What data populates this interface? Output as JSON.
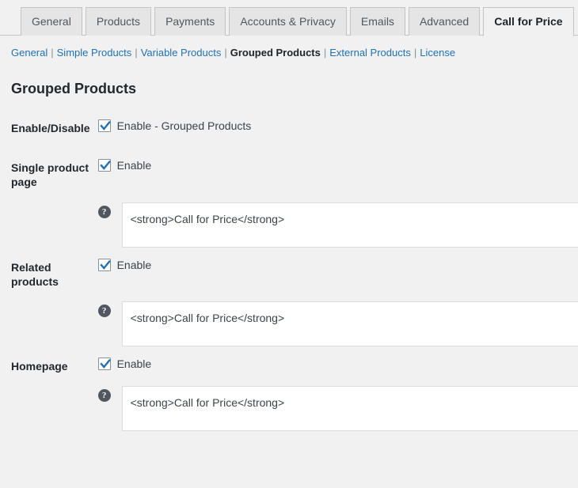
{
  "tabs": [
    {
      "label": "General",
      "active": false
    },
    {
      "label": "Products",
      "active": false
    },
    {
      "label": "Payments",
      "active": false
    },
    {
      "label": "Accounts & Privacy",
      "active": false
    },
    {
      "label": "Emails",
      "active": false
    },
    {
      "label": "Advanced",
      "active": false
    },
    {
      "label": "Call for Price",
      "active": true
    }
  ],
  "subnav": {
    "items": [
      {
        "label": "General",
        "current": false
      },
      {
        "label": "Simple Products",
        "current": false
      },
      {
        "label": "Variable Products",
        "current": false
      },
      {
        "label": "Grouped Products",
        "current": true
      },
      {
        "label": "External Products",
        "current": false
      },
      {
        "label": "License",
        "current": false
      }
    ],
    "separator": "|"
  },
  "heading": "Grouped Products",
  "rows": [
    {
      "label": "Enable/Disable",
      "checkbox_label": "Enable - Grouped Products",
      "checked": true,
      "has_textarea": false
    },
    {
      "label": "Single product page",
      "checkbox_label": "Enable",
      "checked": true,
      "has_textarea": true,
      "textarea_value": "<strong>Call for Price</strong>",
      "help_icon": "help-question-icon",
      "help_glyph": "?"
    },
    {
      "label": "Related products",
      "checkbox_label": "Enable",
      "checked": true,
      "has_textarea": true,
      "textarea_value": "<strong>Call for Price</strong>",
      "help_icon": "help-question-icon",
      "help_glyph": "?"
    },
    {
      "label": "Homepage",
      "checkbox_label": "Enable",
      "checked": true,
      "has_textarea": true,
      "textarea_value": "<strong>Call for Price</strong>",
      "help_icon": "help-question-icon",
      "help_glyph": "?"
    }
  ],
  "colors": {
    "page_background": "#f1f1f1",
    "tab_inactive_background": "#e5e5e5",
    "tab_active_background": "#f1f1f1",
    "border": "#c3c4c7",
    "link": "#2271b1",
    "checkbox_check": "#2271b1",
    "help_icon_background": "#50575e",
    "field_background": "#ffffff",
    "field_border": "#dcdcde"
  }
}
